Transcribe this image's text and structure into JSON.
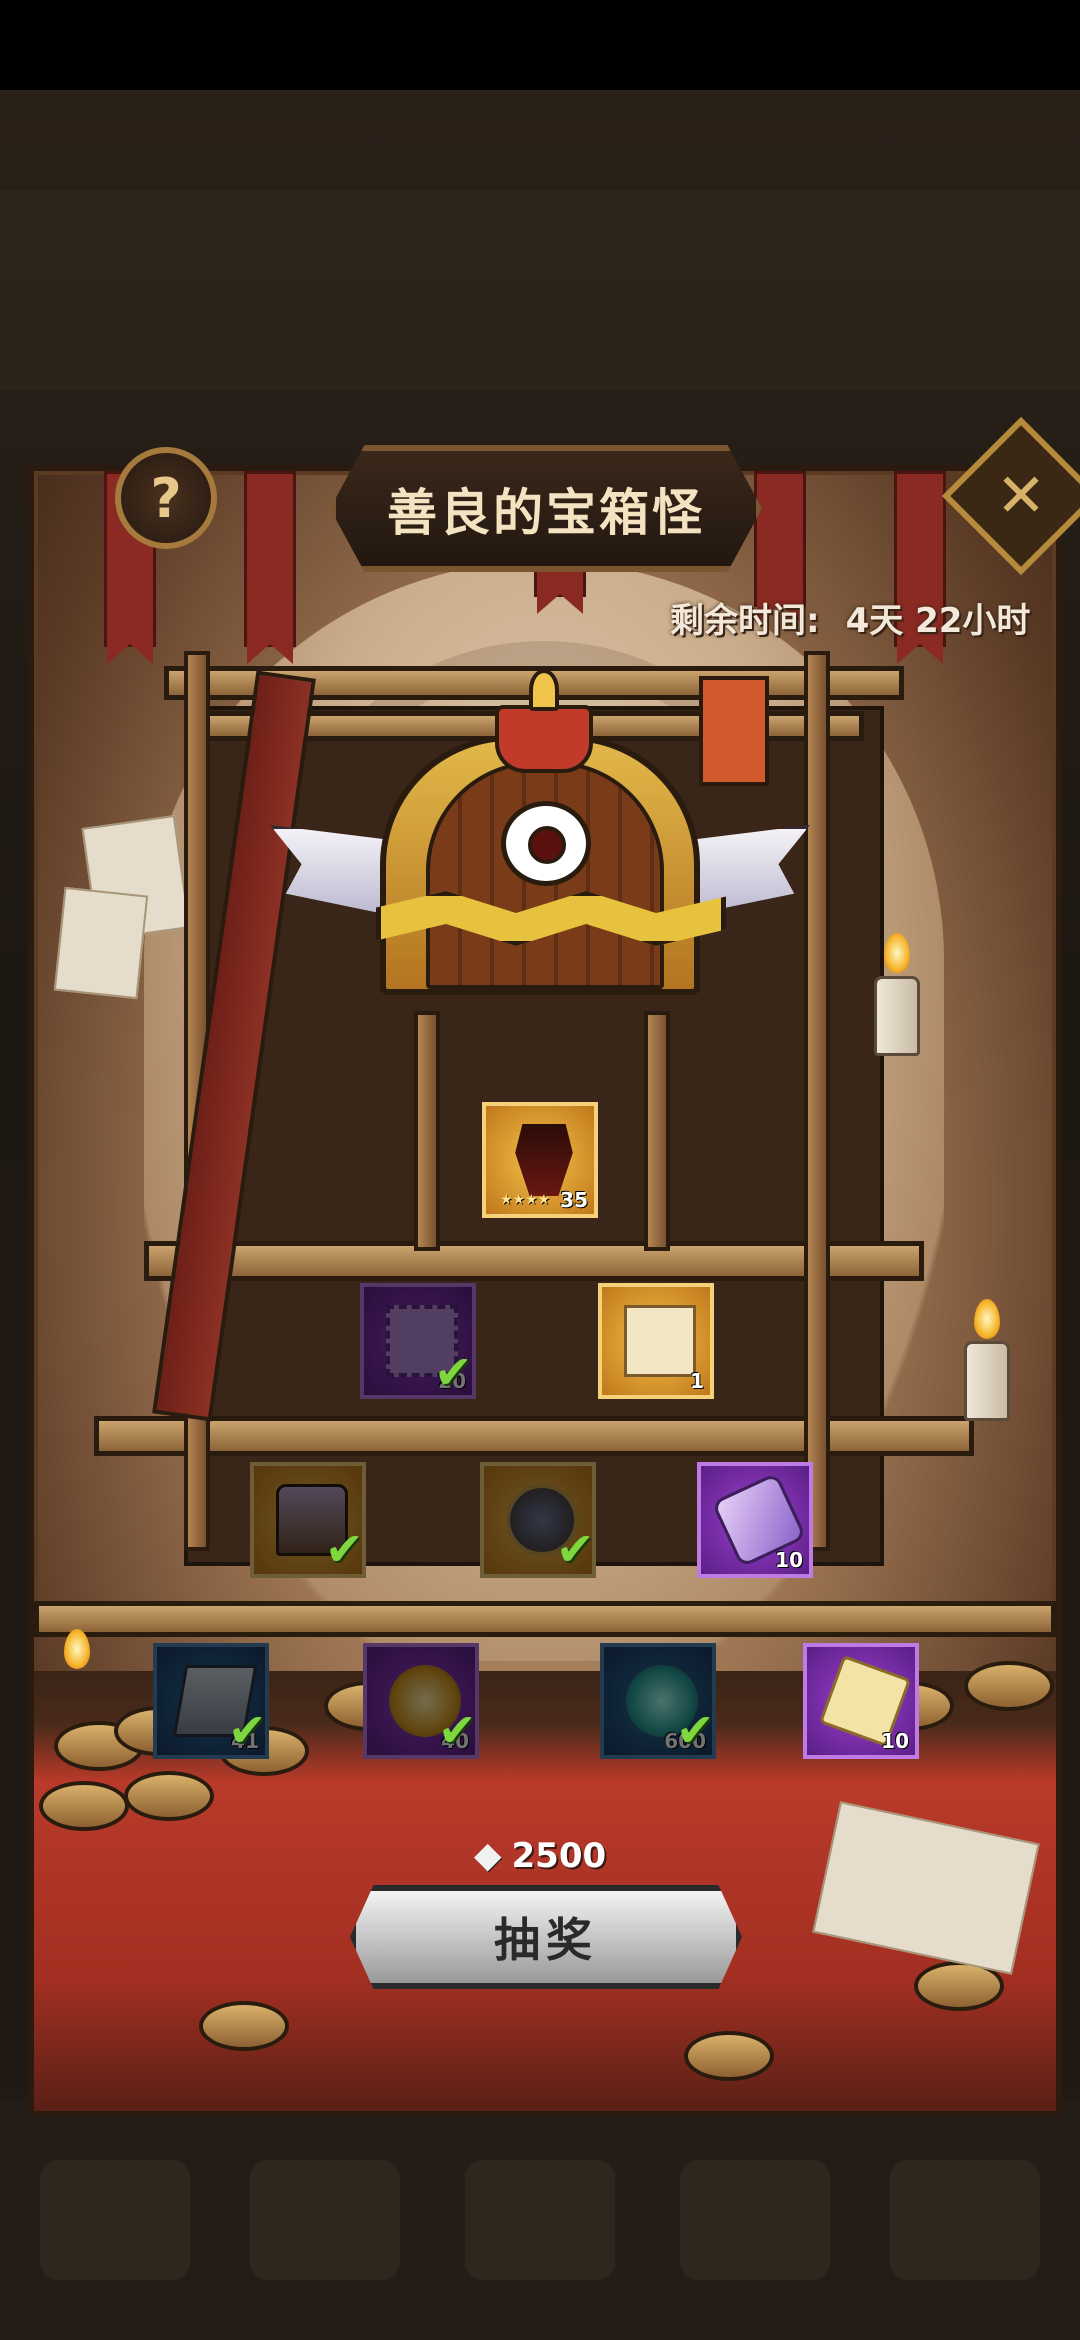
{
  "event": {
    "title": "善良的宝箱怪",
    "timer_label": "剩余时间:",
    "timer_value": "4天 22小时",
    "help_icon": "?",
    "close_icon": "✕"
  },
  "rewards": {
    "row1": [
      {
        "type": "gold",
        "icon": "hero-fragment-icon",
        "count": "35",
        "stars": "★★★★",
        "collected": false
      }
    ],
    "row2": [
      {
        "type": "purple",
        "icon": "stamp-icon",
        "count": "20",
        "collected": true
      },
      {
        "type": "gold",
        "icon": "scroll-icon",
        "count": "1",
        "collected": false
      }
    ],
    "row3": [
      {
        "type": "gold",
        "icon": "treasure-chest-icon",
        "count": "",
        "collected": true
      },
      {
        "type": "gold",
        "icon": "compass-icon",
        "count": "",
        "collected": true
      },
      {
        "type": "purple",
        "icon": "ribbon-icon",
        "count": "10",
        "collected": false
      }
    ],
    "row4": [
      {
        "type": "blue",
        "icon": "book-icon",
        "count": "41",
        "collected": true
      },
      {
        "type": "purple",
        "icon": "gold-orb-icon",
        "count": "40",
        "collected": true
      },
      {
        "type": "blue",
        "icon": "teal-orb-icon",
        "count": "600",
        "collected": true
      },
      {
        "type": "purple",
        "icon": "parchment-icon",
        "count": "10",
        "collected": false
      }
    ]
  },
  "draw": {
    "cost_icon": "diamond-icon",
    "cost": "2500",
    "button_label": "抽奖"
  },
  "colors": {
    "accent_gold": "#b58a3b",
    "carpet_red": "#b93a2a",
    "check_green": "#7ed73f"
  }
}
